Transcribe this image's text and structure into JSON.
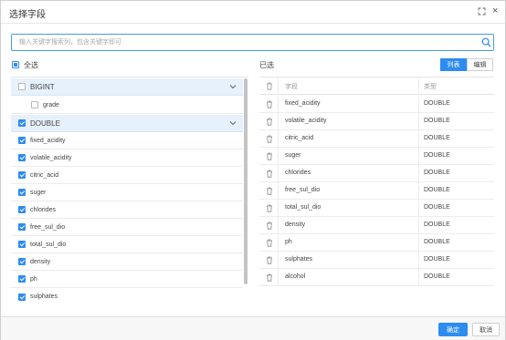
{
  "dialog": {
    "title": "选择字段"
  },
  "search": {
    "placeholder": "输入关键字搜索列，包含关键字即可"
  },
  "select_all_label": "全选",
  "selected_label": "已选",
  "view_toggle": {
    "list_label": "列表",
    "edit_label": "编辑",
    "active": "列表"
  },
  "groups": [
    {
      "label": "BIGINT",
      "state": "unchecked",
      "fields": [
        {
          "label": "grade",
          "checked": false
        }
      ]
    },
    {
      "label": "DOUBLE",
      "state": "checked",
      "fields": [
        {
          "label": "fixed_acidity",
          "checked": true
        },
        {
          "label": "volatile_acidity",
          "checked": true
        },
        {
          "label": "citric_acid",
          "checked": true
        },
        {
          "label": "suger",
          "checked": true
        },
        {
          "label": "chlorides",
          "checked": true
        },
        {
          "label": "free_sul_dio",
          "checked": true
        },
        {
          "label": "total_sul_dio",
          "checked": true
        },
        {
          "label": "density",
          "checked": true
        },
        {
          "label": "ph",
          "checked": true
        },
        {
          "label": "sulphates",
          "checked": true
        }
      ]
    }
  ],
  "selected_table": {
    "headers": {
      "field": "字段",
      "type": "类型"
    },
    "rows": [
      {
        "field": "fixed_acidity",
        "type": "DOUBLE"
      },
      {
        "field": "volatile_acidity",
        "type": "DOUBLE"
      },
      {
        "field": "citric_acid",
        "type": "DOUBLE"
      },
      {
        "field": "suger",
        "type": "DOUBLE"
      },
      {
        "field": "chlorides",
        "type": "DOUBLE"
      },
      {
        "field": "free_sul_dio",
        "type": "DOUBLE"
      },
      {
        "field": "total_sul_dio",
        "type": "DOUBLE"
      },
      {
        "field": "density",
        "type": "DOUBLE"
      },
      {
        "field": "ph",
        "type": "DOUBLE"
      },
      {
        "field": "sulphates",
        "type": "DOUBLE"
      },
      {
        "field": "alcohol",
        "type": "DOUBLE"
      }
    ]
  },
  "footer": {
    "ok_label": "确定",
    "cancel_label": "取消"
  },
  "colors": {
    "accent": "#2d8cf0",
    "group_header_bg": "#e6f1fc"
  },
  "icons": {
    "expand": "expand-icon",
    "close": "close-icon",
    "search": "search-icon",
    "chevron": "chevron-down-icon",
    "delete": "trash-icon"
  }
}
